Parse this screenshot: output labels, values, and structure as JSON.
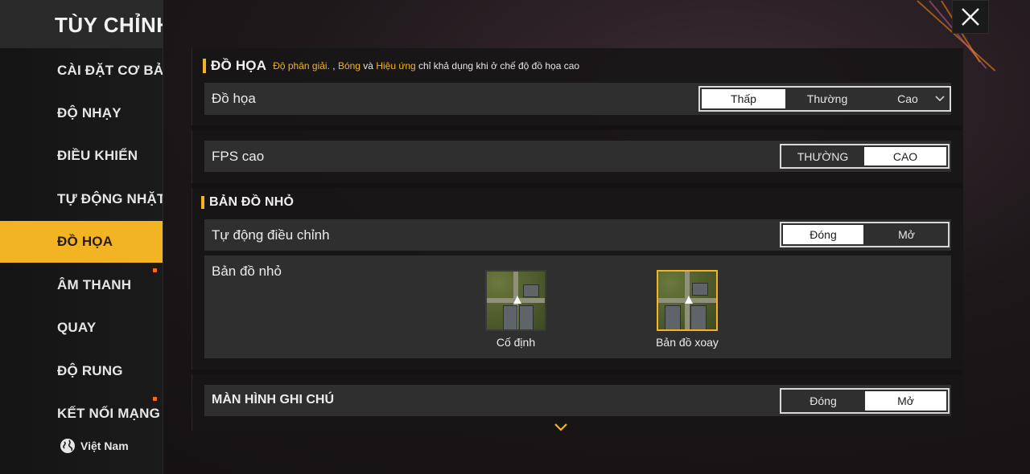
{
  "sidebar": {
    "title": "TÙY CHỈNH",
    "items": [
      {
        "label": "CÀI ĐẶT CƠ BẢN"
      },
      {
        "label": "ĐỘ NHẠY"
      },
      {
        "label": "ĐIỀU KHIỂN"
      },
      {
        "label": "TỰ ĐỘNG NHẶT"
      },
      {
        "label": "ĐỒ HỌA",
        "active": true
      },
      {
        "label": "ÂM THANH"
      },
      {
        "label": "QUAY"
      },
      {
        "label": "ĐỘ RUNG"
      },
      {
        "label": "KẾT NỐI MẠNG"
      }
    ],
    "language": "Việt Nam"
  },
  "graphics": {
    "section_title": "ĐỒ HỌA",
    "note": {
      "part1": "Độ phân giải.",
      "sep1": " , ",
      "part2": "Bóng",
      "sep2": " và ",
      "part3": "Hiệu ứng",
      "rest": " chỉ khả dụng khi ở chế độ đồ họa cao"
    },
    "quality_label": "Đồ họa",
    "quality_options": [
      "Thấp",
      "Thường",
      "Cao"
    ],
    "quality_selected": "Thấp",
    "fps_label": "FPS  cao",
    "fps_options": [
      "THƯỜNG",
      "CAO"
    ],
    "fps_selected": "CAO"
  },
  "minimap": {
    "section_title": "BẢN ĐỒ NHỎ",
    "auto_adjust_label": "Tự động điều chỉnh",
    "auto_adjust_options": [
      "Đóng",
      "Mở"
    ],
    "auto_adjust_selected": "Đóng",
    "map_label": "Bản đồ nhỏ",
    "map_options": [
      {
        "label": "Cố định"
      },
      {
        "label": "Bản đồ xoay",
        "selected": true
      }
    ]
  },
  "note_screen": {
    "label": "MÀN HÌNH GHI CHÚ",
    "options": [
      "Đóng",
      "Mở"
    ],
    "selected": "Mở"
  },
  "colors": {
    "accent": "#f2b423",
    "notification_dot": "#ff6a1a"
  }
}
